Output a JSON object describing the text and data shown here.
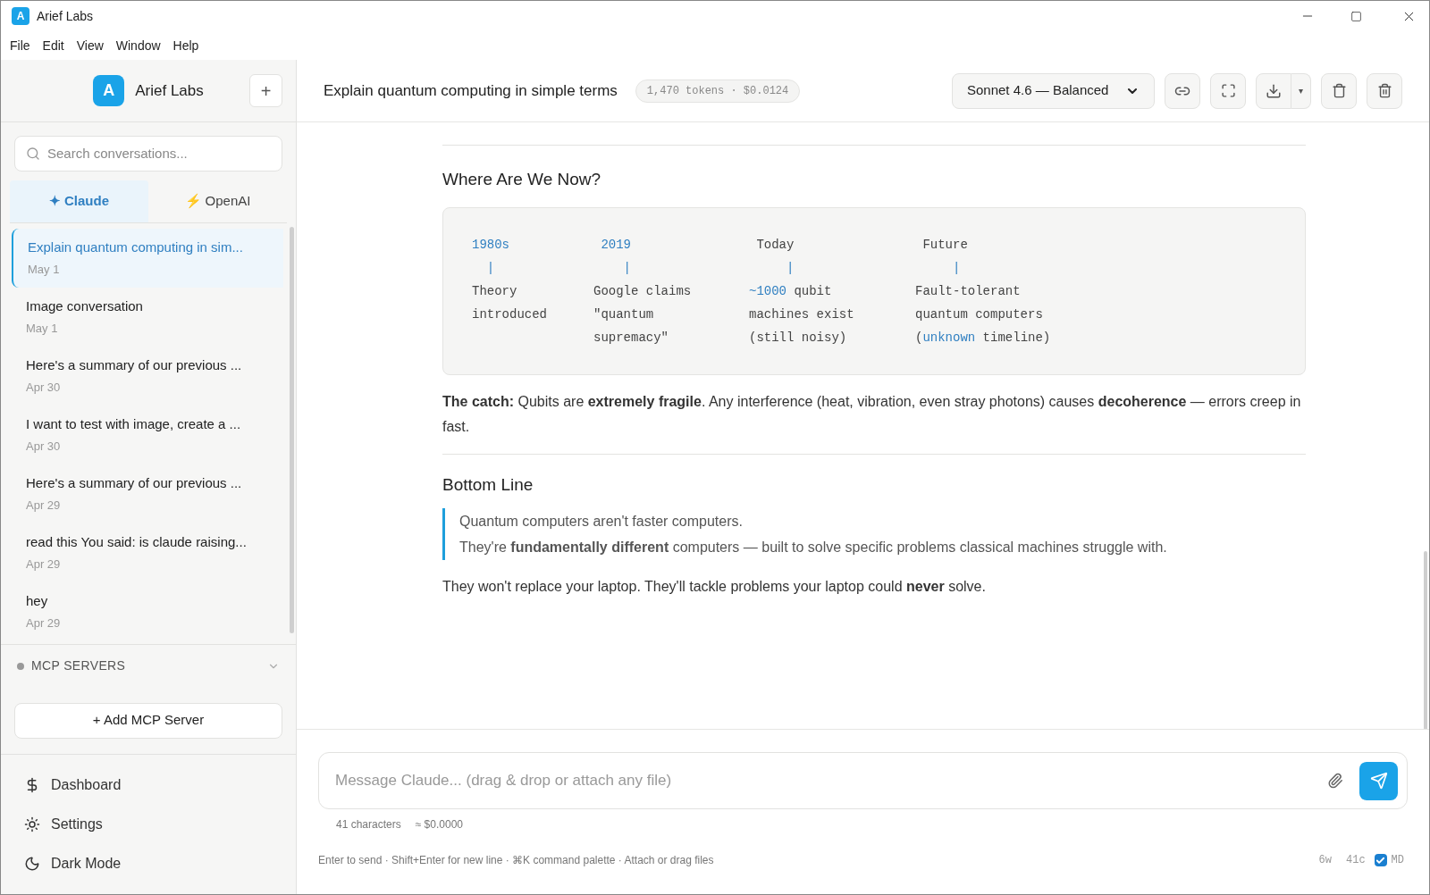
{
  "window": {
    "title": "Arief Labs",
    "logo_letter": "A"
  },
  "menu": [
    "File",
    "Edit",
    "View",
    "Window",
    "Help"
  ],
  "sidebar": {
    "brand": "Arief Labs",
    "brand_letter": "A",
    "new_button": "+",
    "search": {
      "placeholder": "Search conversations..."
    },
    "providers": [
      {
        "icon": "✦",
        "label": "Claude",
        "selected": true
      },
      {
        "icon": "⚡",
        "label": "OpenAI",
        "selected": false
      }
    ],
    "conversations": [
      {
        "title": "Explain quantum computing in sim...",
        "date": "May 1",
        "selected": true
      },
      {
        "title": "Image conversation",
        "date": "May 1",
        "selected": false
      },
      {
        "title": "Here's a summary of our previous ...",
        "date": "Apr 30",
        "selected": false
      },
      {
        "title": "I want to test with image, create a ...",
        "date": "Apr 30",
        "selected": false
      },
      {
        "title": "Here's a summary of our previous ...",
        "date": "Apr 29",
        "selected": false
      },
      {
        "title": "read this You said: is claude raising...",
        "date": "Apr 29",
        "selected": false
      },
      {
        "title": "hey",
        "date": "Apr 29",
        "selected": false
      }
    ],
    "mcp": {
      "title": "MCP SERVERS",
      "expanded": false,
      "add_button": "+ Add MCP Server"
    },
    "nav": [
      {
        "kind": "dollar",
        "label": "Dashboard"
      },
      {
        "kind": "sun",
        "label": "Settings"
      },
      {
        "kind": "moon",
        "label": "Dark Mode"
      }
    ]
  },
  "header": {
    "title": "Explain quantum computing in simple terms",
    "usage": "1,470 tokens · $0.0124",
    "model": "Sonnet 4.6 — Balanced",
    "download_caret": "▾"
  },
  "message": {
    "sections": [
      {
        "kind": "heading",
        "text": "Where Are We Now?"
      },
      {
        "kind": "code",
        "columns": [
          {
            "rows": [
              [
                {
                  "t": "1980s",
                  "accent": true
                }
              ],
              [
                {
                  "t": "  |",
                  "accent": true
                }
              ],
              [
                {
                  "t": "Theory",
                  "accent": false
                }
              ],
              [
                {
                  "t": "introduced",
                  "accent": false
                }
              ]
            ]
          },
          {
            "rows": [
              [
                {
                  "t": " 2019",
                  "accent": true
                }
              ],
              [
                {
                  "t": "    |",
                  "accent": true
                }
              ],
              [
                {
                  "t": "Google claims",
                  "accent": false
                }
              ],
              [
                {
                  "t": "\"quantum",
                  "accent": false
                }
              ],
              [
                {
                  "t": "supremacy\"",
                  "accent": false
                }
              ]
            ]
          },
          {
            "rows": [
              [
                {
                  "t": " Today",
                  "accent": false
                }
              ],
              [
                {
                  "t": "     |",
                  "accent": true
                }
              ],
              [
                {
                  "t": "~1000",
                  "accent": true
                },
                {
                  "t": " qubit",
                  "accent": false
                }
              ],
              [
                {
                  "t": "machines exist",
                  "accent": false
                }
              ],
              [
                {
                  "t": "(still noisy)",
                  "accent": false
                }
              ]
            ]
          },
          {
            "rows": [
              [
                {
                  "t": " Future",
                  "accent": false
                }
              ],
              [
                {
                  "t": "     |",
                  "accent": true
                }
              ],
              [
                {
                  "t": "Fault-tolerant",
                  "accent": false
                }
              ],
              [
                {
                  "t": "quantum computers",
                  "accent": false
                }
              ],
              [
                {
                  "t": "(",
                  "accent": false
                },
                {
                  "t": "unknown",
                  "accent": true
                },
                {
                  "t": " timeline)",
                  "accent": false
                }
              ]
            ]
          }
        ]
      },
      {
        "kind": "paragraph",
        "text": "**The catch:** Qubits are **extremely fragile**. Any interference (heat, vibration, even stray photons) causes **decoherence** — errors creep in fast."
      },
      {
        "kind": "rule"
      },
      {
        "kind": "heading",
        "text": "Bottom Line"
      },
      {
        "kind": "quote",
        "lines": [
          "Quantum computers aren't faster computers.",
          "They're **fundamentally different** computers — built to solve specific problems classical machines struggle with."
        ]
      },
      {
        "kind": "paragraph",
        "text": "They won't replace your laptop. They'll tackle problems your laptop could **never** solve."
      }
    ]
  },
  "composer": {
    "placeholder": "Message Claude... (drag & drop or attach any file)",
    "char_count": "41 characters",
    "cost": "≈ $0.0000",
    "hint": "Enter to send · Shift+Enter for new line · ⌘K command palette · Attach or drag files",
    "words": "6w",
    "chars": "41c",
    "md": {
      "label": "MD",
      "checked": true
    }
  }
}
